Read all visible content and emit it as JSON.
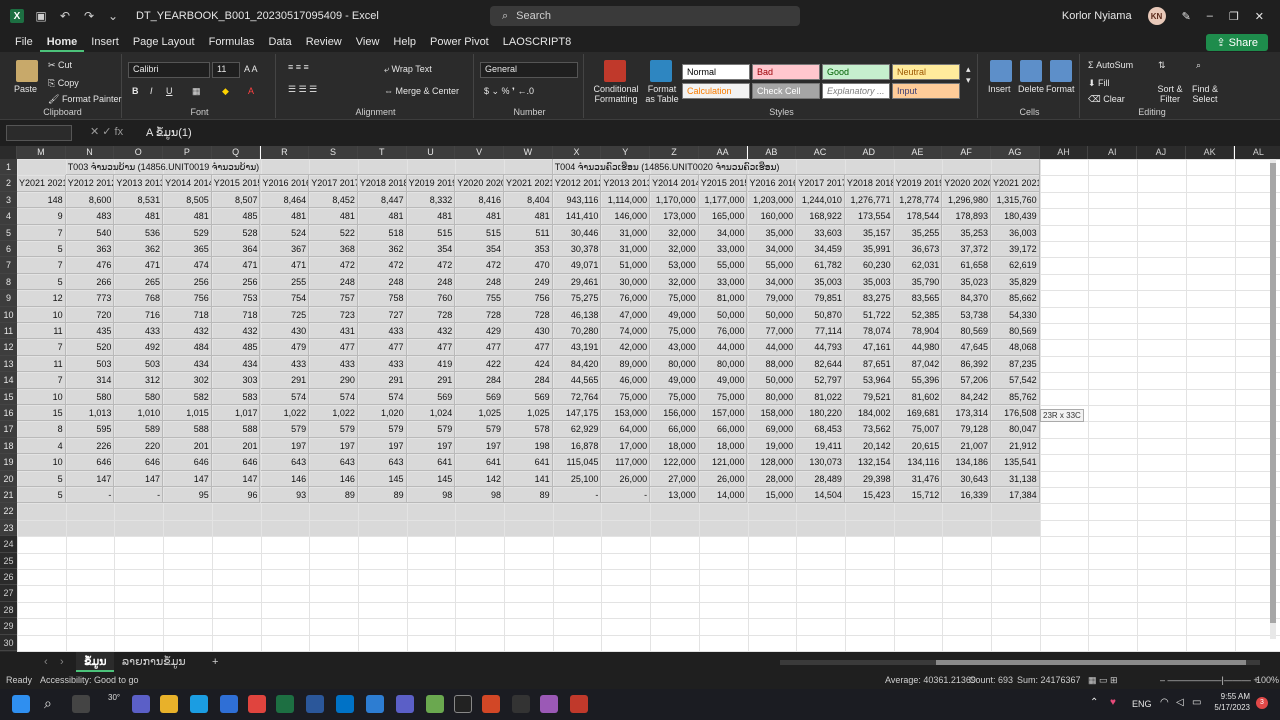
{
  "app": {
    "file_name": "DT_YEARBOOK_B001_20230517095409",
    "app_name": "Excel",
    "search_placeholder": "Search",
    "user_name": "Korlor Nyiama",
    "user_initials": "KN"
  },
  "menu": [
    "File",
    "Home",
    "Insert",
    "Page Layout",
    "Formulas",
    "Data",
    "Review",
    "View",
    "Help",
    "Power Pivot",
    "LAOSCRIPT8"
  ],
  "share_label": "Share",
  "ribbon": {
    "clipboard": {
      "paste": "Paste",
      "cut": "Cut",
      "copy": "Copy",
      "format_painter": "Format Painter",
      "label": "Clipboard"
    },
    "font": {
      "name": "Calibri",
      "size": "11",
      "label": "Font"
    },
    "alignment": {
      "wrap": "Wrap Text",
      "merge": "Merge & Center",
      "label": "Alignment"
    },
    "number": {
      "format": "General",
      "label": "Number"
    },
    "styles": {
      "conditional": "Conditional Formatting",
      "format_table": "Format as Table",
      "label": "Styles",
      "cells": [
        {
          "name": "Normal",
          "bg": "#ffffff",
          "fg": "#000000"
        },
        {
          "name": "Bad",
          "bg": "#ffc7ce",
          "fg": "#9c0006"
        },
        {
          "name": "Good",
          "bg": "#c6efce",
          "fg": "#006100"
        },
        {
          "name": "Neutral",
          "bg": "#ffeb9c",
          "fg": "#9c5700"
        },
        {
          "name": "Calculation",
          "bg": "#f2f2f2",
          "fg": "#fa7d00"
        },
        {
          "name": "Check Cell",
          "bg": "#a5a5a5",
          "fg": "#ffffff"
        },
        {
          "name": "Explanatory ...",
          "bg": "#ffffff",
          "fg": "#7f7f7f"
        },
        {
          "name": "Input",
          "bg": "#ffcc99",
          "fg": "#3f3f76"
        }
      ]
    },
    "cells": {
      "insert": "Insert",
      "delete": "Delete",
      "format": "Format",
      "label": "Cells"
    },
    "editing": {
      "autosum": "AutoSum",
      "fill": "Fill",
      "clear": "Clear",
      "sort": "Sort & Filter",
      "find": "Find & Select",
      "label": "Editing"
    }
  },
  "formula_bar": {
    "name_box": "",
    "content": "A ຂໍ້ມູນ(1)"
  },
  "columns": [
    "M",
    "N",
    "O",
    "P",
    "Q",
    "R",
    "S",
    "T",
    "U",
    "V",
    "W",
    "X",
    "Y",
    "Z",
    "AA",
    "AB",
    "AC",
    "AD",
    "AE",
    "AF",
    "AG",
    "AH",
    "AI",
    "AJ",
    "AK",
    "AL"
  ],
  "header_row1": {
    "t003": "T003 ຈໍານວນບ້ານ (14856.UNIT0019 ຈໍານວນບ້ານ)",
    "t004": "T004 ຈໍານວນຄົວເຮືອນ (14856.UNIT0020 ຈໍານວນຄົວເຮືອນ)"
  },
  "header_row2": [
    "Y2021 2021",
    "Y2012 2012",
    "Y2013 2013",
    "Y2014 2014",
    "Y2015 2015",
    "Y2016 2016",
    "Y2017 2017",
    "Y2018 2018",
    "Y2019 2019",
    "Y2020 2020",
    "Y2021 2021",
    "Y2012 2012",
    "Y2013 2013",
    "Y2014 2014",
    "Y2015 2015",
    "Y2016 2016",
    "Y2017 2017",
    "Y2018 2018",
    "Y2019 2019",
    "Y2020 2020",
    "Y2021 2021"
  ],
  "rows": [
    [
      "148",
      "8,600",
      "8,531",
      "8,505",
      "8,507",
      "8,464",
      "8,452",
      "8,447",
      "8,332",
      "8,416",
      "8,404",
      "943,116",
      "1,114,000",
      "1,170,000",
      "1,177,000",
      "1,203,000",
      "1,244,010",
      "1,276,771",
      "1,278,774",
      "1,296,980",
      "1,315,760"
    ],
    [
      "9",
      "483",
      "481",
      "481",
      "485",
      "481",
      "481",
      "481",
      "481",
      "481",
      "481",
      "141,410",
      "146,000",
      "173,000",
      "165,000",
      "160,000",
      "168,922",
      "173,554",
      "178,544",
      "178,893",
      "180,439"
    ],
    [
      "7",
      "540",
      "536",
      "529",
      "528",
      "524",
      "522",
      "518",
      "515",
      "515",
      "511",
      "30,446",
      "31,000",
      "32,000",
      "34,000",
      "35,000",
      "33,603",
      "35,157",
      "35,255",
      "35,253",
      "36,003"
    ],
    [
      "5",
      "363",
      "362",
      "365",
      "364",
      "367",
      "368",
      "362",
      "354",
      "354",
      "353",
      "30,378",
      "31,000",
      "32,000",
      "33,000",
      "34,000",
      "34,459",
      "35,991",
      "36,673",
      "37,372",
      "39,172"
    ],
    [
      "7",
      "476",
      "471",
      "474",
      "471",
      "471",
      "472",
      "472",
      "472",
      "472",
      "470",
      "49,071",
      "51,000",
      "53,000",
      "55,000",
      "55,000",
      "61,782",
      "60,230",
      "62,031",
      "61,658",
      "62,619"
    ],
    [
      "5",
      "266",
      "265",
      "256",
      "256",
      "255",
      "248",
      "248",
      "248",
      "248",
      "249",
      "29,461",
      "30,000",
      "32,000",
      "33,000",
      "34,000",
      "35,003",
      "35,003",
      "35,790",
      "35,023",
      "35,829"
    ],
    [
      "12",
      "773",
      "768",
      "756",
      "753",
      "754",
      "757",
      "758",
      "760",
      "755",
      "756",
      "75,275",
      "76,000",
      "75,000",
      "81,000",
      "79,000",
      "79,851",
      "83,275",
      "83,565",
      "84,370",
      "85,662"
    ],
    [
      "10",
      "720",
      "716",
      "718",
      "718",
      "725",
      "723",
      "727",
      "728",
      "728",
      "728",
      "46,138",
      "47,000",
      "49,000",
      "50,000",
      "50,000",
      "50,870",
      "51,722",
      "52,385",
      "53,738",
      "54,330"
    ],
    [
      "11",
      "435",
      "433",
      "432",
      "432",
      "430",
      "431",
      "433",
      "432",
      "429",
      "430",
      "70,280",
      "74,000",
      "75,000",
      "76,000",
      "77,000",
      "77,114",
      "78,074",
      "78,904",
      "80,569",
      "80,569"
    ],
    [
      "7",
      "520",
      "492",
      "484",
      "485",
      "479",
      "477",
      "477",
      "477",
      "477",
      "477",
      "43,191",
      "42,000",
      "43,000",
      "44,000",
      "44,000",
      "44,793",
      "47,161",
      "44,980",
      "47,645",
      "48,068"
    ],
    [
      "11",
      "503",
      "503",
      "434",
      "434",
      "433",
      "433",
      "433",
      "419",
      "422",
      "424",
      "84,420",
      "89,000",
      "80,000",
      "80,000",
      "88,000",
      "82,644",
      "87,651",
      "87,042",
      "86,392",
      "87,235"
    ],
    [
      "7",
      "314",
      "312",
      "302",
      "303",
      "291",
      "290",
      "291",
      "291",
      "284",
      "284",
      "44,565",
      "46,000",
      "49,000",
      "49,000",
      "50,000",
      "52,797",
      "53,964",
      "55,396",
      "57,206",
      "57,542"
    ],
    [
      "10",
      "580",
      "580",
      "582",
      "583",
      "574",
      "574",
      "574",
      "569",
      "569",
      "569",
      "72,764",
      "75,000",
      "75,000",
      "75,000",
      "80,000",
      "81,022",
      "79,521",
      "81,602",
      "84,242",
      "85,762"
    ],
    [
      "15",
      "1,013",
      "1,010",
      "1,015",
      "1,017",
      "1,022",
      "1,022",
      "1,020",
      "1,024",
      "1,025",
      "1,025",
      "147,175",
      "153,000",
      "156,000",
      "157,000",
      "158,000",
      "180,220",
      "184,002",
      "169,681",
      "173,314",
      "176,508"
    ],
    [
      "8",
      "595",
      "589",
      "588",
      "588",
      "579",
      "579",
      "579",
      "579",
      "579",
      "578",
      "62,929",
      "64,000",
      "66,000",
      "66,000",
      "69,000",
      "68,453",
      "73,562",
      "75,007",
      "79,128",
      "80,047"
    ],
    [
      "4",
      "226",
      "220",
      "201",
      "201",
      "197",
      "197",
      "197",
      "197",
      "197",
      "198",
      "16,878",
      "17,000",
      "18,000",
      "18,000",
      "19,000",
      "19,411",
      "20,142",
      "20,615",
      "21,007",
      "21,912"
    ],
    [
      "10",
      "646",
      "646",
      "646",
      "646",
      "643",
      "643",
      "643",
      "641",
      "641",
      "641",
      "115,045",
      "117,000",
      "122,000",
      "121,000",
      "128,000",
      "130,073",
      "132,154",
      "134,116",
      "134,186",
      "135,541"
    ],
    [
      "5",
      "147",
      "147",
      "147",
      "147",
      "146",
      "146",
      "145",
      "145",
      "142",
      "141",
      "25,100",
      "26,000",
      "27,000",
      "26,000",
      "28,000",
      "28,489",
      "29,398",
      "31,476",
      "30,643",
      "31,138"
    ],
    [
      "5",
      "-",
      "-",
      "95",
      "96",
      "93",
      "89",
      "89",
      "98",
      "98",
      "89",
      "-",
      "-",
      "13,000",
      "14,000",
      "15,000",
      "14,504",
      "15,423",
      "15,712",
      "16,339",
      "17,384"
    ]
  ],
  "selection_tag": "23R x 33C",
  "sheet_tabs": [
    "ຂໍ້ມູນ",
    "ລາຍການຂໍ້ມູນ"
  ],
  "status": {
    "ready": "Ready",
    "accessibility": "Accessibility: Good to go",
    "average": "Average: 40361.21369",
    "count": "Count: 693",
    "sum": "Sum: 24176367",
    "zoom": "100%"
  },
  "taskbar": {
    "temp": "30°",
    "lang": "ENG",
    "time": "9:55 AM",
    "date": "5/17/2023",
    "notif": "3"
  }
}
